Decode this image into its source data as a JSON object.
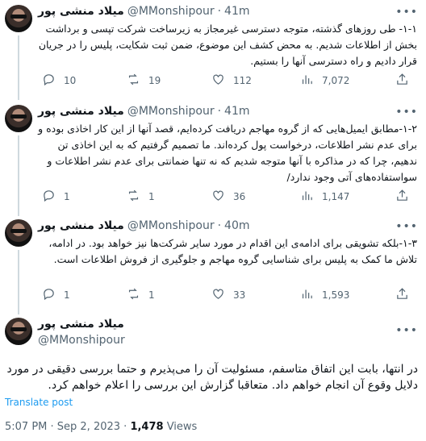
{
  "author": {
    "name": "میلاد منشی پور",
    "handle": "@MMonshipour"
  },
  "tweets": [
    {
      "time": "41m",
      "text": "۱-۱- طی روزهای گذشته، متوجه دسترسی غیرمجاز به زیرساخت شرکت تپسی و برداشت بخش از اطلاعات شدیم. به محض کشف این موضوع، ضمن ثبت شکایت، پلیس را در جریان قرار دادیم و راه دسترسی آنها را بستیم.",
      "replies": "10",
      "retweets": "19",
      "likes": "112",
      "views": "7,072"
    },
    {
      "time": "41m",
      "text": "۱-۲-مطابق ایمیل‌هایی که از گروه مهاجم دریافت کرده‌ایم، قصد آنها از این کار اخاذی بوده و برای عدم نشر اطلاعات، درخواست پول کرده‌اند. ما تصمیم گرفتیم که به این اخاذی تن ندهیم، چرا که در مذاکره با آنها متوجه شدیم که نه تنها ضمانتی برای عدم نشر اطلاعات و سواستفاده‌های آتی وجود ندارد/",
      "replies": "1",
      "retweets": "1",
      "likes": "36",
      "views": "1,147"
    },
    {
      "time": "40m",
      "text": "۱-۳-بلکه تشویقی برای ادامه‌ی این اقدام در مورد سایر شرکت‌ها نیز خواهد بود. در ادامه، تلاش ما کمک به پلیس برای شناسایی گروه مهاجم و جلوگیری از فروش اطلاعات است.",
      "replies": "1",
      "retweets": "1",
      "likes": "33",
      "views": "1,593"
    }
  ],
  "main_tweet": {
    "text": "در انتها، بابت این اتفاق متاسفم، مسئولیت آن را می‌پذیرم و حتما بررسی دقیقی در مورد دلایل وقوع آن انجام خواهم داد. متعاقبا گزارش این بررسی را اعلام خواهم کرد.",
    "translate": "Translate post",
    "timestamp": "5:07 PM · Sep 2, 2023 · ",
    "views_count": "1,478",
    "views_label": " Views"
  },
  "separator": "·",
  "icons": [
    "reply-icon",
    "retweet-icon",
    "like-icon",
    "views-icon",
    "share-icon",
    "more-icon"
  ]
}
